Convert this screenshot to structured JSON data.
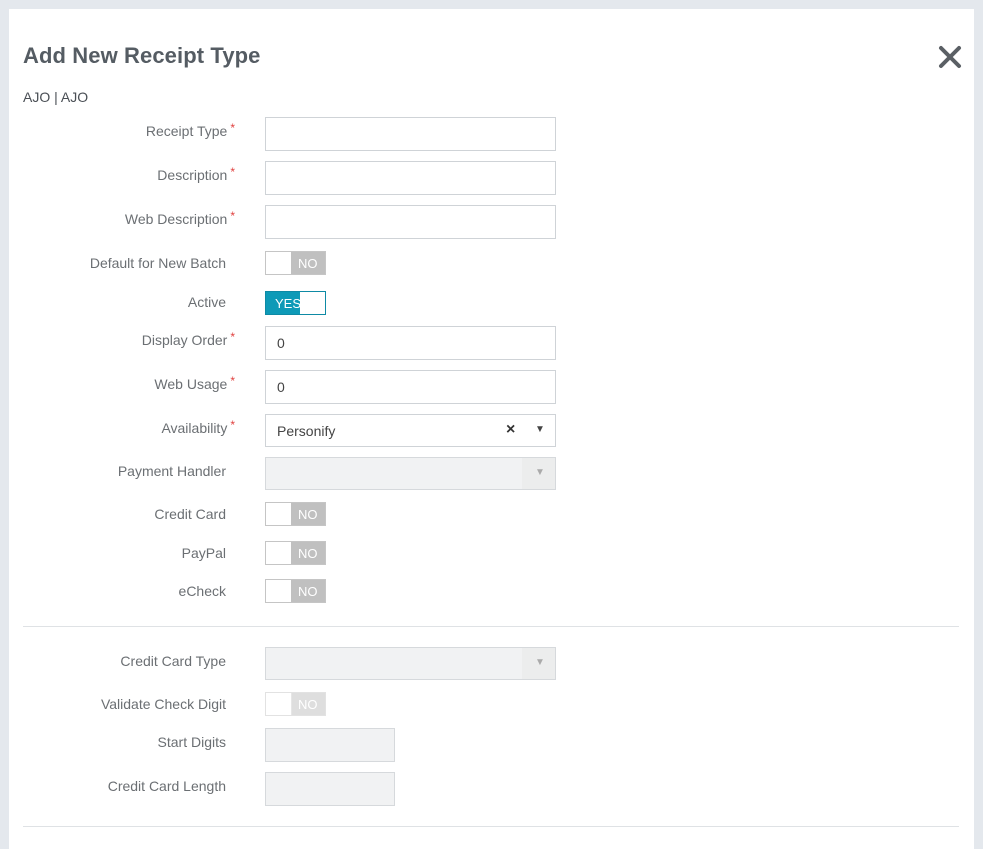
{
  "dialog": {
    "title": "Add New Receipt Type",
    "subtitle": "AJO | AJO",
    "close_icon": "close-icon"
  },
  "required_marker": "*",
  "fields": {
    "receipt_type": {
      "label": "Receipt Type",
      "value": ""
    },
    "description": {
      "label": "Description",
      "value": ""
    },
    "web_description": {
      "label": "Web Description",
      "value": ""
    },
    "default_for_new_batch": {
      "label": "Default for New Batch",
      "state": "NO"
    },
    "active": {
      "label": "Active",
      "state": "YES"
    },
    "display_order": {
      "label": "Display Order",
      "value": "0"
    },
    "web_usage": {
      "label": "Web Usage",
      "value": "0"
    },
    "availability": {
      "label": "Availability",
      "value": "Personify",
      "clear_glyph": "×",
      "arrow_glyph": "▼"
    },
    "payment_handler": {
      "label": "Payment Handler",
      "value": "",
      "arrow_glyph": "▼"
    },
    "credit_card": {
      "label": "Credit Card",
      "state": "NO"
    },
    "paypal": {
      "label": "PayPal",
      "state": "NO"
    },
    "echeck": {
      "label": "eCheck",
      "state": "NO"
    },
    "credit_card_type": {
      "label": "Credit Card Type",
      "value": "",
      "arrow_glyph": "▼"
    },
    "validate_check_digit": {
      "label": "Validate Check Digit",
      "state": "NO"
    },
    "start_digits": {
      "label": "Start Digits",
      "value": ""
    },
    "credit_card_length": {
      "label": "Credit Card Length",
      "value": ""
    }
  },
  "colors": {
    "accent": "#0e9ab7",
    "required": "#e0413f",
    "toggle_off": "#c0c0c0"
  }
}
